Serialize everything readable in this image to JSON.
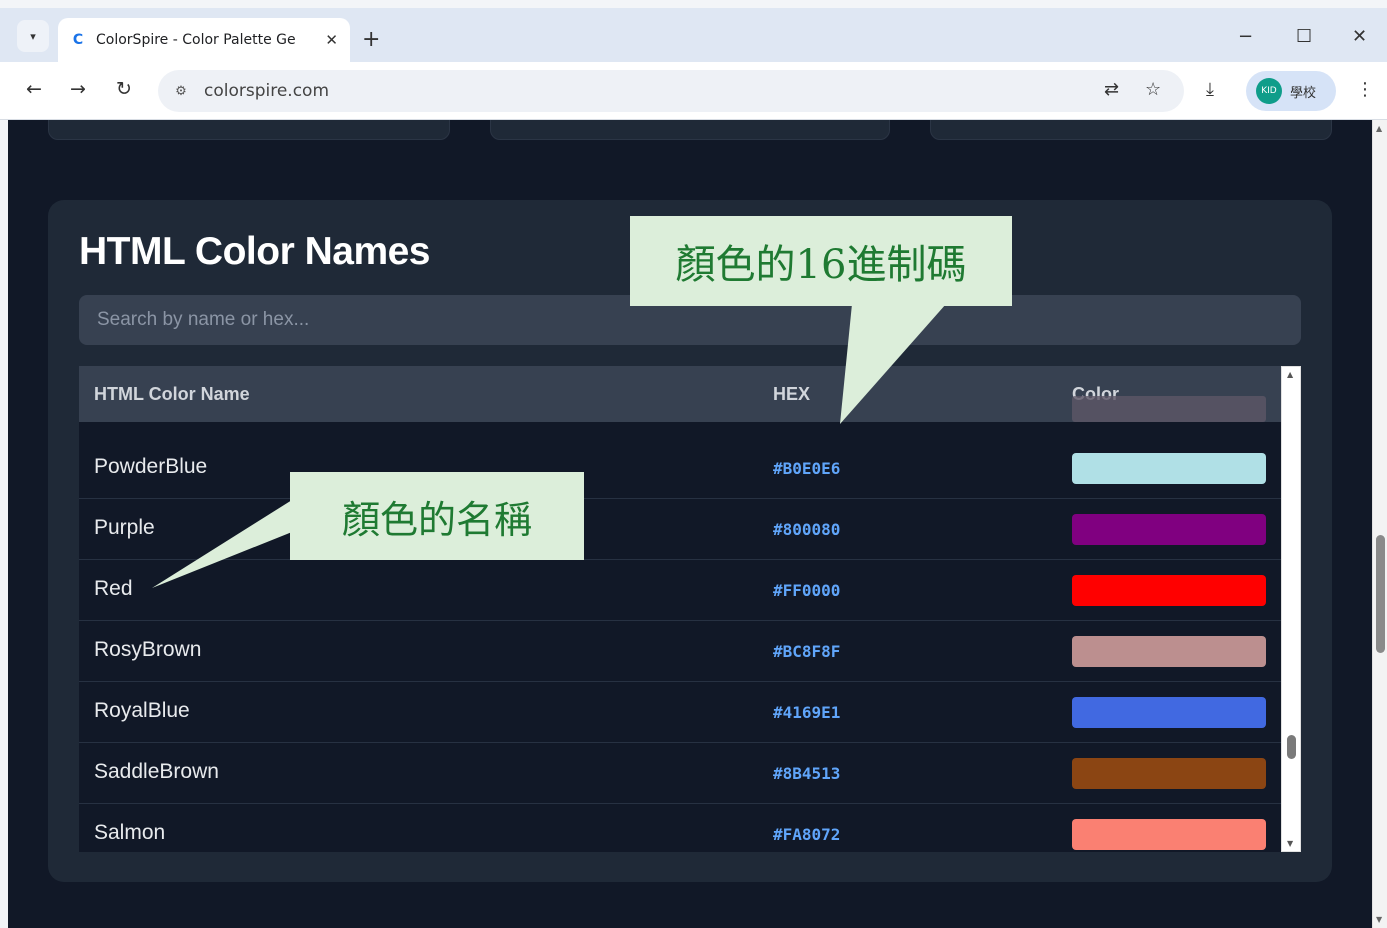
{
  "browser": {
    "tab_title": "ColorSpire - Color Palette Ge",
    "favicon_letter": "C",
    "close_glyph": "✕",
    "new_tab_glyph": "+",
    "url": "colorspire.com",
    "profile_label": "學校",
    "avatar_text": "KID"
  },
  "page": {
    "title": "HTML Color Names",
    "search_placeholder": "Search by name or hex...",
    "table": {
      "headers": {
        "name": "HTML Color Name",
        "hex": "HEX",
        "color": "Color"
      },
      "rows": [
        {
          "name": "PowderBlue",
          "hex": "#B0E0E6",
          "color": "#B0E0E6"
        },
        {
          "name": "Purple",
          "hex": "#800080",
          "color": "#800080"
        },
        {
          "name": "Red",
          "hex": "#FF0000",
          "color": "#FF0000"
        },
        {
          "name": "RosyBrown",
          "hex": "#BC8F8F",
          "color": "#BC8F8F"
        },
        {
          "name": "RoyalBlue",
          "hex": "#4169E1",
          "color": "#4169E1"
        },
        {
          "name": "SaddleBrown",
          "hex": "#8B4513",
          "color": "#8B4513"
        },
        {
          "name": "Salmon",
          "hex": "#FA8072",
          "color": "#FA8072"
        }
      ]
    }
  },
  "annotations": {
    "hex_callout": "顏色的16進制碼",
    "name_callout": "顏色的名稱"
  },
  "colors": {
    "page_bg": "#111827",
    "panel_bg": "#1f2937",
    "header_bg": "#374151",
    "hex_text": "#60a5fa",
    "callout_bg": "#dceeda",
    "callout_text": "#1f7a32"
  }
}
